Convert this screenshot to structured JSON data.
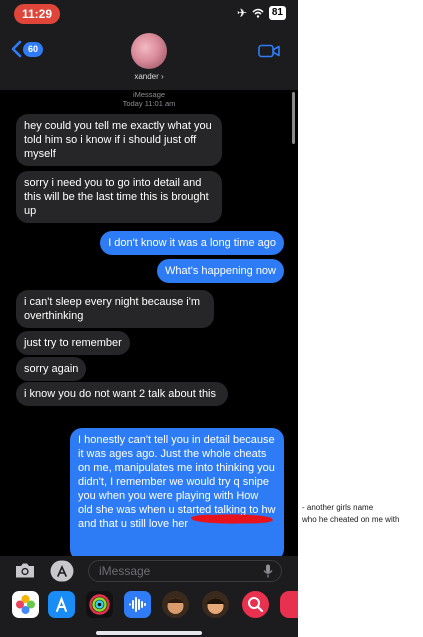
{
  "status_bar": {
    "time": "11:29",
    "battery": "81"
  },
  "header": {
    "back_badge": "60",
    "contact_name": "xander ›"
  },
  "conversation": {
    "service": "iMessage",
    "timestamp": "Today 11:01 am",
    "messages": [
      {
        "direction": "received",
        "text": "hey could you tell me exactly what you told him so i know if i should just off myself"
      },
      {
        "direction": "received",
        "text": "sorry i need you to go into detail and this will be the last time this is brought up"
      },
      {
        "direction": "sent",
        "text": "I don't know it was a long time ago"
      },
      {
        "direction": "sent",
        "text": "What's happening now"
      },
      {
        "direction": "received",
        "text": "i can't sleep every night because i'm overthinking"
      },
      {
        "direction": "received",
        "text": "just try to remember"
      },
      {
        "direction": "received",
        "text": "sorry again"
      },
      {
        "direction": "received",
        "text": "i know you do not want 2 talk about this"
      },
      {
        "direction": "sent",
        "text": "I honestly can't tell you in detail because it was ages ago. Just the whole cheats on me, manipulates me into thinking you didn't, I remember we would try q snipe you when you were playing with  How old she was when u started talking to hw and that u still love her"
      }
    ]
  },
  "input": {
    "placeholder": "iMessage"
  },
  "annotation": {
    "line1": "- another girls name",
    "line2": "who he cheated on me with"
  },
  "icons": [
    "back-chevron-icon",
    "video-call-icon",
    "camera-icon",
    "app-store-icon",
    "microphone-icon",
    "photos-app-icon",
    "app-store-app-icon",
    "fitness-app-icon",
    "audio-app-icon",
    "memoji-icon",
    "search-images-icon"
  ],
  "colors": {
    "sent_bubble": "#2d7cf6",
    "received_bubble": "#262628",
    "redaction": "#e8131b",
    "time_pill": "#e0453a"
  }
}
